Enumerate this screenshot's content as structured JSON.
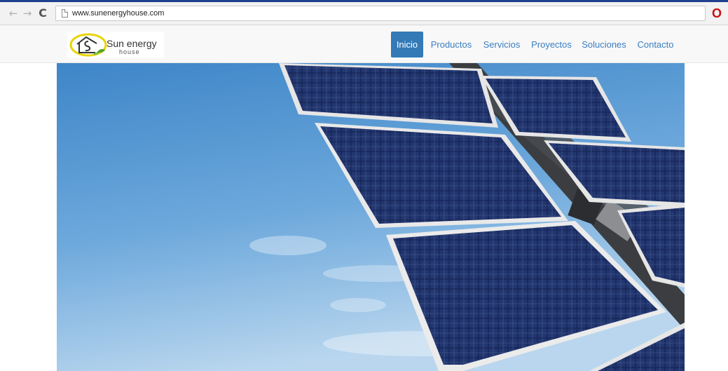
{
  "browser": {
    "url": "www.sunenergyhouse.com",
    "back_icon": "←",
    "forward_icon": "→",
    "reload_icon": "C",
    "opera_icon": "O",
    "accent": "#1f3f8f"
  },
  "site": {
    "logo": {
      "word_top": "Sun energy",
      "word_bottom": "house"
    },
    "nav": [
      {
        "label": "Inicio",
        "active": true
      },
      {
        "label": "Productos",
        "active": false
      },
      {
        "label": "Servicios",
        "active": false
      },
      {
        "label": "Proyectos",
        "active": false
      },
      {
        "label": "Soluciones",
        "active": false
      },
      {
        "label": "Contacto",
        "active": false
      }
    ],
    "colors": {
      "nav_active_bg": "#337ab7",
      "nav_link": "#3a7fc0",
      "logo_yellow": "#e8d400",
      "logo_green": "#5aa02c"
    }
  },
  "hero": {
    "image": "solar-panels-against-blue-sky"
  }
}
